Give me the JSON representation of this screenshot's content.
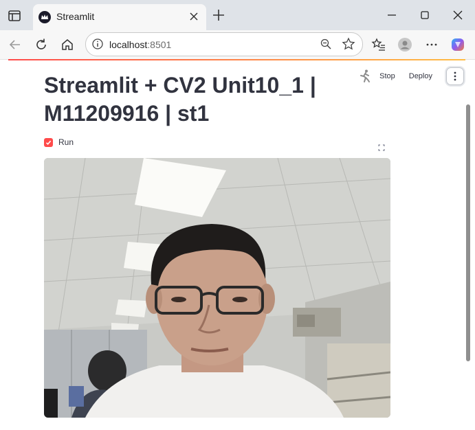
{
  "browser": {
    "tab_title": "Streamlit",
    "url_host": "localhost",
    "url_port": ":8501"
  },
  "app": {
    "title": "Streamlit + CV2 Unit10_1 | M11209916 | st1",
    "stop_label": "Stop",
    "deploy_label": "Deploy",
    "checkbox_label": "Run",
    "checkbox_checked": true
  },
  "colors": {
    "accent": "#ff4b4b",
    "text": "#31333f"
  },
  "icons": {
    "sidebar": "sidebar-toggle-icon",
    "favicon": "streamlit-crown-icon",
    "close": "close-icon",
    "new_tab": "plus-icon",
    "back": "back-arrow-icon",
    "reload": "reload-icon",
    "home": "home-icon",
    "info": "info-icon",
    "zoom": "zoom-out-icon",
    "favorite": "star-icon",
    "collections": "favorites-list-icon",
    "profile": "avatar-icon",
    "more": "more-icon",
    "copilot": "copilot-icon",
    "running": "running-man-icon",
    "fullscreen": "fullscreen-icon"
  }
}
